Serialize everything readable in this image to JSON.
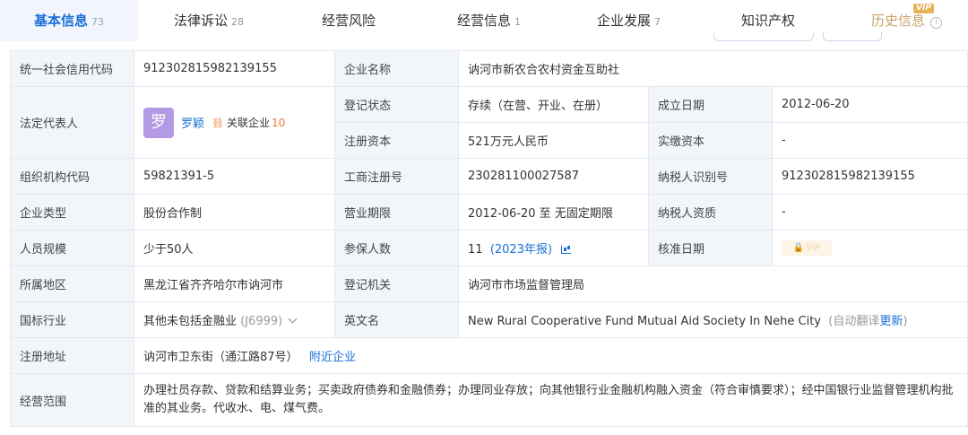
{
  "tabs": [
    {
      "label": "基本信息",
      "count": "73"
    },
    {
      "label": "法律诉讼",
      "count": "28"
    },
    {
      "label": "经营风险",
      "count": ""
    },
    {
      "label": "经营信息",
      "count": "1"
    },
    {
      "label": "企业发展",
      "count": "7"
    },
    {
      "label": "知识产权",
      "count": ""
    },
    {
      "label": "历史信息",
      "count": "",
      "badge": "VIP"
    }
  ],
  "info": {
    "credit_code_label": "统一社会信用代码",
    "credit_code": "912302815982139155",
    "company_name_label": "企业名称",
    "company_name": "讷河市新农合农村资金互助社",
    "legal_rep_label": "法定代表人",
    "legal_rep_avatar": "罗",
    "legal_rep_name": "罗颖",
    "related_label": "关联企业",
    "related_count": "10",
    "reg_status_label": "登记状态",
    "reg_status": "存续（在营、开业、在册）",
    "found_date_label": "成立日期",
    "found_date": "2012-06-20",
    "reg_capital_label": "注册资本",
    "reg_capital": "521万元人民币",
    "paid_capital_label": "实缴资本",
    "paid_capital": "-",
    "org_code_label": "组织机构代码",
    "org_code": "59821391-5",
    "biz_reg_no_label": "工商注册号",
    "biz_reg_no": "230281100027587",
    "taxpayer_id_label": "纳税人识别号",
    "taxpayer_id": "912302815982139155",
    "company_type_label": "企业类型",
    "company_type": "股份合作制",
    "biz_term_label": "营业期限",
    "biz_term": "2012-06-20 至 无固定期限",
    "taxpayer_qual_label": "纳税人资质",
    "taxpayer_qual": "-",
    "staff_size_label": "人员规模",
    "staff_size": "少于50人",
    "insured_label": "参保人数",
    "insured_count": "11",
    "insured_year": "(2023年报)",
    "approve_date_label": "核准日期",
    "approve_date_badge": "VIP",
    "region_label": "所属地区",
    "region": "黑龙江省齐齐哈尔市讷河市",
    "reg_authority_label": "登记机关",
    "reg_authority": "讷河市市场监督管理局",
    "industry_label": "国标行业",
    "industry": "其他未包括金融业",
    "industry_code": "(J6999)",
    "english_name_label": "英文名",
    "english_name": "New Rural Cooperative Fund Mutual Aid Society In Nehe City",
    "auto_translate": "(自动翻译",
    "update_label": "更新",
    "close_paren": ")",
    "address_label": "注册地址",
    "address": "讷河市卫东街（通江路87号）",
    "nearby_label": "附近企业",
    "scope_label": "经营范围",
    "scope": "办理社员存款、贷款和结算业务；买卖政府债券和金融债券；办理同业存放；向其他银行业金融机构融入资金（符合审慎要求）；经中国银行业监督管理机构批准的其业务。代收水、电、煤气费。"
  }
}
